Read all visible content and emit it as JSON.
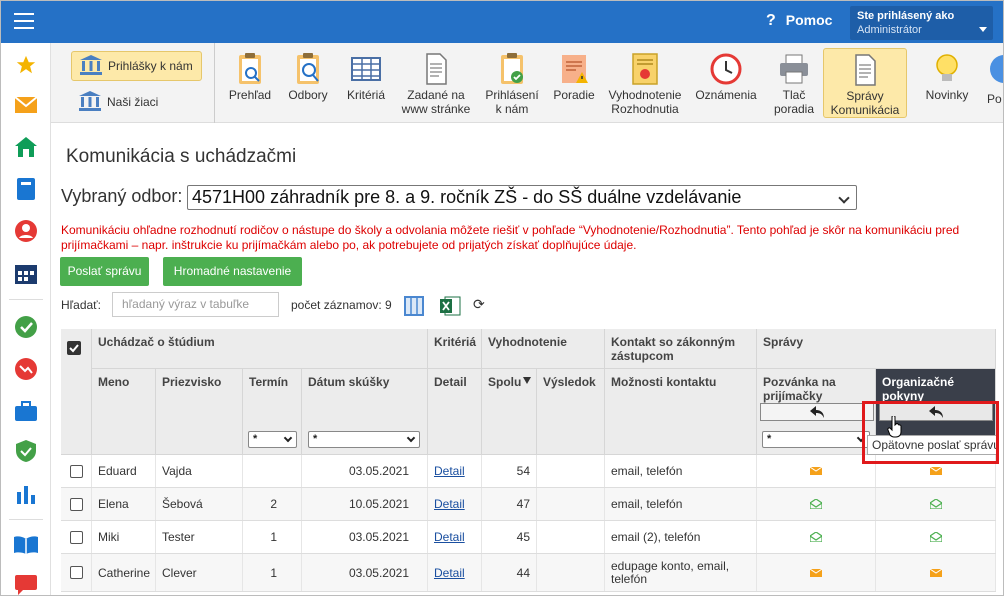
{
  "header": {
    "help_label": "Pomoc",
    "user_line1": "Ste prihlásený ako",
    "user_line2": "Administrátor"
  },
  "sidebar": {
    "icons": [
      "star-icon",
      "mail-icon",
      "home-icon",
      "book-icon",
      "person-icon",
      "calendar-icon",
      "check-icon",
      "chart-down-icon",
      "briefcase-icon",
      "shield-check-icon",
      "bar-chart-icon",
      "open-book-icon",
      "chat-icon"
    ]
  },
  "toolbar": {
    "left": [
      {
        "label": "Prihlášky k nám",
        "active": true
      },
      {
        "label": "Naši žiaci",
        "active": false
      }
    ],
    "buttons": [
      {
        "label": "Prehľad"
      },
      {
        "label": "Odbory"
      },
      {
        "label": "Kritériá"
      },
      {
        "label": "Zadané na www stránke"
      },
      {
        "label": "Prihlásení k nám"
      },
      {
        "label": "Poradie"
      },
      {
        "label": "Vyhodnotenie Rozhodnutia"
      },
      {
        "label": "Oznámenia"
      },
      {
        "label": "Tlač poradia"
      },
      {
        "label": "Správy Komunikácia",
        "active": true
      },
      {
        "label": "Novinky"
      },
      {
        "label": "Po"
      }
    ]
  },
  "page": {
    "title": "Komunikácia s uchádzačmi",
    "odbor_label": "Vybraný odbor:",
    "odbor_value": "4571H00 záhradník pre 8. a 9. ročník ZŠ - do SŠ duálne vzdelávanie",
    "notice": "Komunikáciu ohľadne rozhodnutí rodičov o nástupe do školy a odvolania môžete riešiť v pohľade “Vyhodnotenie/Rozhodnutia”. Tento pohľad je skôr na komunikáciu pred prijímačkami – napr. inštrukcie ku prijímačkám alebo po, ak potrebujete od prijatých získať doplňujúce údaje.",
    "send_button": "Poslať správu",
    "bulk_button": "Hromadné nastavenie",
    "search_label": "Hľadať:",
    "search_placeholder": "hľadaný výraz v tabuľke",
    "count_label": "počet záznamov: 9"
  },
  "table": {
    "group_headers": {
      "applicant": "Uchádzač o štúdium",
      "criteria": "Kritériá",
      "evaluation": "Vyhodnotenie",
      "contact": "Kontakt so zákonným zástupcom",
      "messages": "Správy"
    },
    "columns": {
      "first_name": "Meno",
      "last_name": "Priezvisko",
      "term": "Termín",
      "exam_date": "Dátum skúšky",
      "detail": "Detail",
      "total": "Spolu",
      "result": "Výsledok",
      "contact_options": "Možnosti kontaktu",
      "invitation": "Pozvánka na prijímačky",
      "org_instructions": "Organizačné pokyny"
    },
    "filters": {
      "term": "*",
      "exam_date": "*",
      "invitation": "*"
    },
    "rows": [
      {
        "first": "Eduard",
        "last": "Vajda",
        "term": "",
        "date": "03.05.2021",
        "detail": "Detail",
        "total": "54",
        "result": "",
        "contact": "email, telefón",
        "inv_status": "sent",
        "org_status": "sent"
      },
      {
        "first": "Elena",
        "last": "Šebová",
        "term": "2",
        "date": "10.05.2021",
        "detail": "Detail",
        "total": "47",
        "result": "",
        "contact": "email, telefón",
        "inv_status": "read",
        "org_status": "read"
      },
      {
        "first": "Miki",
        "last": "Tester",
        "term": "1",
        "date": "03.05.2021",
        "detail": "Detail",
        "total": "45",
        "result": "",
        "contact": "email (2), telefón",
        "inv_status": "read",
        "org_status": "read"
      },
      {
        "first": "Catherine",
        "last": "Clever",
        "term": "1",
        "date": "03.05.2021",
        "detail": "Detail",
        "total": "44",
        "result": "",
        "contact": "edupage konto, email, telefón",
        "inv_status": "sent",
        "org_status": "sent"
      }
    ]
  },
  "tooltip": "Opätovne poslať správu",
  "colors": {
    "topbar": "#2571c6",
    "green": "#4caf50",
    "active_yellow": "#fde9a9",
    "notice_red": "#dd0000",
    "highlight_red": "#e0191b",
    "env_sent": "#f5a11a",
    "env_read": "#4caf50"
  }
}
